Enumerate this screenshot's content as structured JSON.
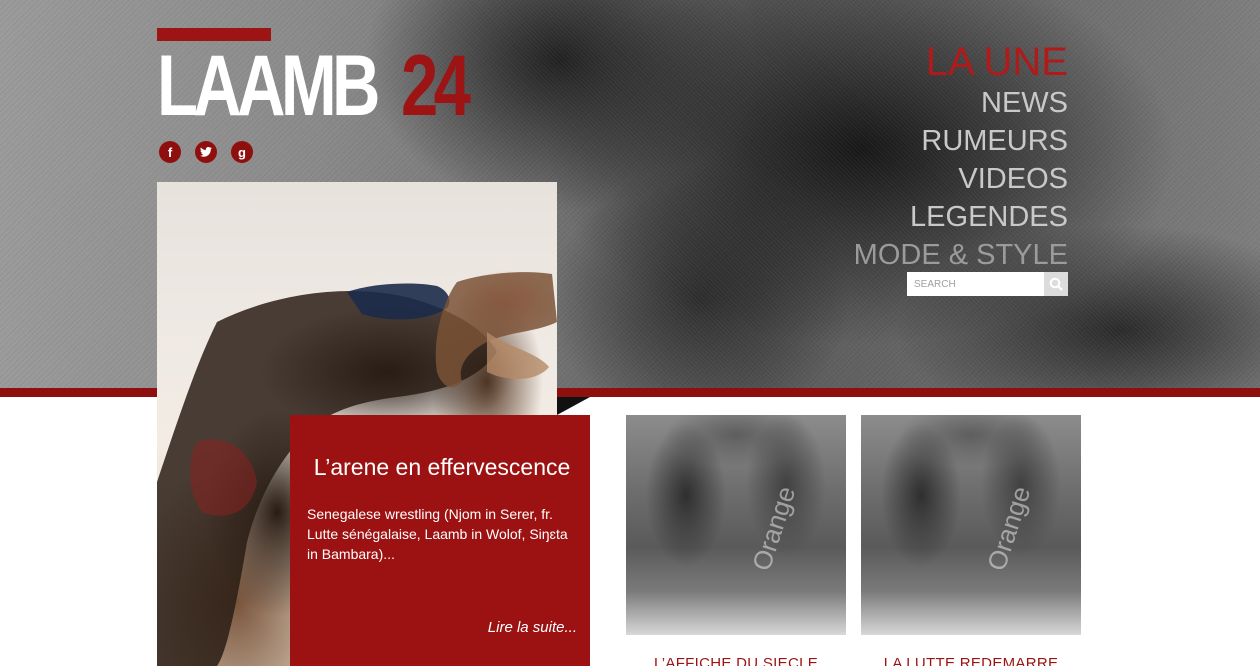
{
  "logo": {
    "main": "LAAMB",
    "number": "24"
  },
  "social": [
    {
      "icon": "facebook-icon",
      "glyph": "f"
    },
    {
      "icon": "twitter-icon",
      "glyph": "t"
    },
    {
      "icon": "google-icon",
      "glyph": "g"
    }
  ],
  "nav": {
    "items": [
      {
        "label": "LA UNE",
        "active": true
      },
      {
        "label": "NEWS"
      },
      {
        "label": "RUMEURS"
      },
      {
        "label": "VIDEOS"
      },
      {
        "label": "LEGENDES"
      },
      {
        "label": "MODE & STYLE"
      }
    ]
  },
  "search": {
    "placeholder": "SEARCH",
    "icon": "search-icon"
  },
  "featured": {
    "title": "L’arene en effervescence",
    "excerpt": "Senegalese wrestling (Njom in Serer, fr. Lutte sénégalaise, Laamb in Wolof, Siŋɛta in Bambara)...",
    "read_more": "Lire la suite..."
  },
  "cards": [
    {
      "title": "L’AFFICHE DU SIECLE",
      "image_text": "Orange"
    },
    {
      "title": "LA LUTTE REDEMARRE",
      "image_text": "Orange"
    }
  ],
  "colors": {
    "brand_red": "#9c1212",
    "accent_red": "#b01a1a",
    "nav_grey": "#c9c9c9"
  }
}
